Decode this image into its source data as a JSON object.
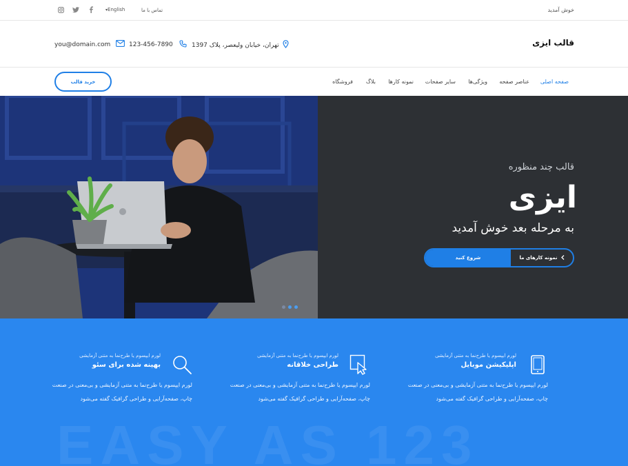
{
  "topbar": {
    "welcome": "خوش آمدید",
    "contact": "تماس با ما",
    "language": "English",
    "social_icons": [
      "facebook-icon",
      "twitter-icon",
      "instagram-icon"
    ]
  },
  "header": {
    "logo": "قالب ایزی",
    "address": "تهران، خیابان ولیعصر، پلاک 1397",
    "phone": "123-456-7890",
    "email": "you@domain.com"
  },
  "nav": {
    "items": [
      "صفحه اصلی",
      "عناصر صفحه",
      "ویژگی‌ها",
      "سایر صفحات",
      "نمونه کارها",
      "بلاگ",
      "فروشگاه"
    ],
    "buy_button": "خرید قالب"
  },
  "hero": {
    "subtitle": "قالب چند منظوره",
    "title": "ایزی",
    "tagline": "به مرحله بعد خوش آمدید",
    "primary_button": "شروع کنید",
    "secondary_button": "نمونه کارهای ما"
  },
  "features": {
    "watermark": "EASY AS 123",
    "items": [
      {
        "small": "لورم ایپسوم یا طرح‌نما به متنی آزمایشی",
        "title": "اپلیکیشن موبایل",
        "desc": "لورم ایپسوم یا طرح‌نما به متنی آزمایشی و بی‌معنی در صنعت چاپ، صفحه‌آرایی و طراحی گرافیک گفته می‌شود",
        "icon": "tablet-icon"
      },
      {
        "small": "لورم ایپسوم یا طرح‌نما به متنی آزمایشی",
        "title": "طراحی خلاقانه",
        "desc": "لورم ایپسوم یا طرح‌نما به متنی آزمایشی و بی‌معنی در صنعت چاپ، صفحه‌آرایی و طراحی گرافیک گفته می‌شود",
        "icon": "cursor-icon"
      },
      {
        "small": "لورم ایپسوم یا طرح‌نما به متنی آزمایشی",
        "title": "بهینه شده برای سئو",
        "desc": "لورم ایپسوم یا طرح‌نما به متنی آزمایشی و بی‌معنی در صنعت چاپ، صفحه‌آرایی و طراحی گرافیک گفته می‌شود",
        "icon": "magnifier-icon"
      }
    ]
  },
  "colors": {
    "accent": "#1f7fe6",
    "hero_bg": "#2d3034",
    "features_bg": "#2a87ef"
  }
}
